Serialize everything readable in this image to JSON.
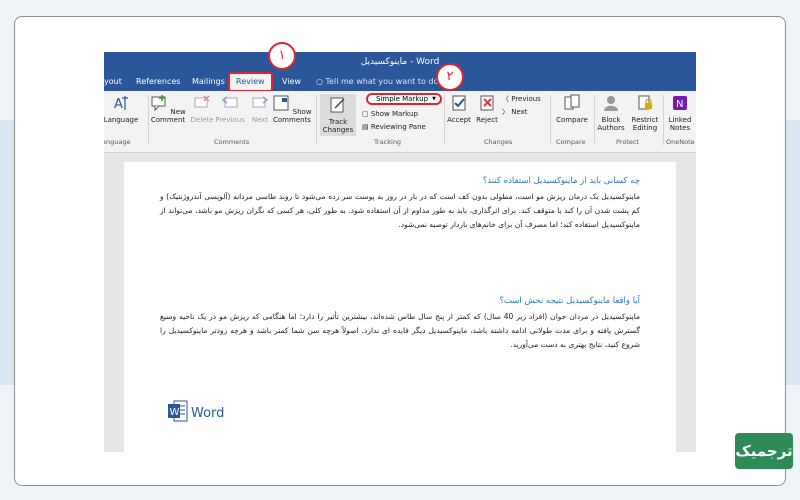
{
  "window": {
    "title": "ماینوکسیدیل - Word"
  },
  "tabs": [
    {
      "label": "yout"
    },
    {
      "label": "References"
    },
    {
      "label": "Mailings"
    },
    {
      "label": "Review"
    },
    {
      "label": "View"
    }
  ],
  "tell_me": "Tell me what you want to do...",
  "ribbon": {
    "language": {
      "label": "Language",
      "group": "anguage"
    },
    "comments": {
      "new": "New Comment",
      "delete": "Delete",
      "previous": "Previous",
      "next": "Next",
      "show": "Show Comments",
      "group": "Comments"
    },
    "tracking": {
      "track_changes": "Track Changes",
      "markup_dropdown": "Simple Markup",
      "show_markup": "Show Markup",
      "reviewing_pane": "Reviewing Pane",
      "group": "Tracking"
    },
    "changes": {
      "accept": "Accept",
      "reject": "Reject",
      "previous": "Previous",
      "next": "Next",
      "group": "Changes"
    },
    "compare": {
      "label": "Compare",
      "group": "Compare"
    },
    "protect": {
      "block": "Block Authors",
      "restrict": "Restrict Editing",
      "group": "Protect"
    },
    "onenote": {
      "linked": "Linked Notes",
      "group": "OneNote"
    }
  },
  "document": {
    "heading1": "چه کسانی باید از ماینوکسیدیل استفاده کنند؟",
    "para1": "ماینوکسیدیل یک درمان ریزش مو است، مطولی بدون کف است که در بار در روز به پوست سر زده می‌شود تا روند طاسی مردانه (آلوپسی آندروژنتیک) و کم پشت شدن آن را کند یا متوقف کند. برای اثرگذاری، باید به طور مداوم از آن استفاده شود. به طور کلی، هر کسی که نگران ریزش مو باشد، می‌تواند از ماینوکسیدیل استفاده کند؛ اما مصرف آن برای خانم‌های باردار توصیه نمی‌شود.",
    "heading2": "آیا واقعا ماینوکسیدیل نتیجه بخش است؟",
    "para2": "ماینوکسیدیل در مردان جوان (افراد زیر 40 سال) که کمتر از پنج سال طاس شده‌اند، بیشترین تأثیر را دارد؛ اما هنگامی که ریزش مو در یک ناحیه وسیع گسترش یافته و برای مدت طولانی ادامه داشته باشد، ماینوکسیدیل دیگر فایده ای ندارد. اصولاً هرچه سن شما کمتر باشد و هرچه زودتر ماینوکسیدیل را شروع کنید، نتایج بهتری به دست می‌آورید.",
    "logo_text": "Word"
  },
  "annotations": {
    "step1": "١",
    "step2": "٢"
  },
  "brand": "ترجمیک"
}
